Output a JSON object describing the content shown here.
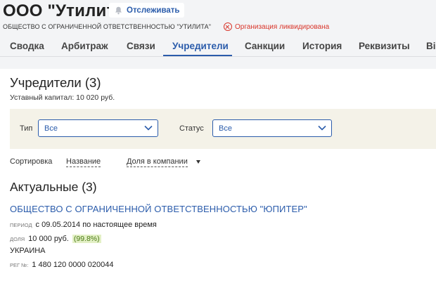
{
  "header": {
    "title": "ООО \"Утилита\"",
    "follow_label": "Отслеживать",
    "full_name": "ОБЩЕСТВО С ОГРАНИЧЕННОЙ ОТВЕТСТВЕННОСТЬЮ \"УТИЛИТА\"",
    "status_text": "Организация ликвидирована",
    "status_color": "#d9362b"
  },
  "tabs": [
    {
      "label": "Сводка",
      "active": false
    },
    {
      "label": "Арбитраж",
      "active": false
    },
    {
      "label": "Связи",
      "active": false
    },
    {
      "label": "Учредители",
      "active": true
    },
    {
      "label": "Санкции",
      "active": false
    },
    {
      "label": "История",
      "active": false
    },
    {
      "label": "Реквизиты",
      "active": false
    },
    {
      "label": "Ві",
      "active": false
    }
  ],
  "section": {
    "title": "Учредители (3)",
    "capital": "Уставный капитал: 10 020 руб."
  },
  "filters": {
    "type_label": "Тип",
    "type_value": "Все",
    "status_label": "Статус",
    "status_value": "Все"
  },
  "sort": {
    "label": "Сортировка",
    "by_name": "Название",
    "by_share": "Доля в компании"
  },
  "current": {
    "title": "Актуальные (3)",
    "items": [
      {
        "name": "ОБЩЕСТВО С ОГРАНИЧЕННОЙ ОТВЕТСТВЕННОСТЬЮ \"ЮПИТЕР\"",
        "period_label": "ПЕРИОД",
        "period": "с 09.05.2014 по настоящее время",
        "share_label": "ДОЛЯ",
        "share_amount": "10 000 руб.",
        "share_percent": "(99.8%)",
        "country": "УКРАИНА",
        "reg_label": "РЕГ №:",
        "reg_number": "1 480 120 0000 020044"
      }
    ]
  },
  "colors": {
    "accent": "#2b5cab",
    "share_badge_bg": "#e3f0c6",
    "filter_bg": "#f4f2e8"
  }
}
